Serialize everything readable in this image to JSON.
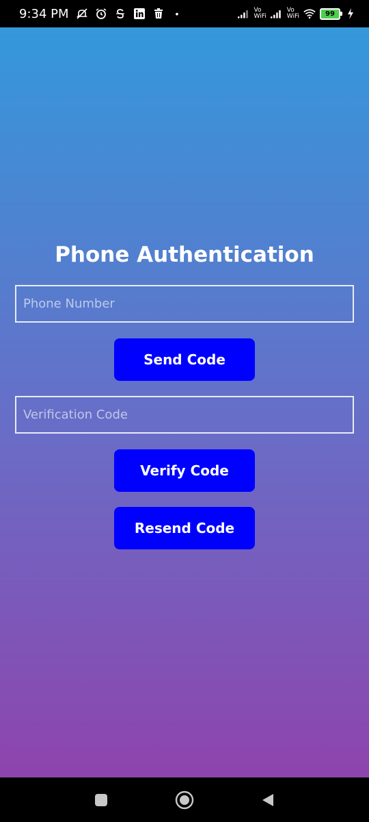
{
  "status_bar": {
    "time": "9:34 PM",
    "dot": "•",
    "vo_wifi_1": "Vo\nWiFi",
    "vo_wifi_2": "Vo\nWiFi",
    "battery": "99",
    "icons": [
      "mute-icon",
      "alarm-icon",
      "s-icon",
      "linkedin-icon",
      "delete-icon",
      "signal-icon",
      "wifi-icon",
      "charging-icon"
    ]
  },
  "screen": {
    "title": "Phone Authentication",
    "phone_placeholder": "Phone Number",
    "code_placeholder": "Verification Code",
    "send_code_label": "Send Code",
    "verify_code_label": "Verify Code",
    "resend_code_label": "Resend Code",
    "gradient_top": "#3498db",
    "gradient_bottom": "#8e44ad",
    "button_color": "#0000ff"
  },
  "nav_bar": {
    "icons": [
      "recents-square-icon",
      "home-circle-icon",
      "back-triangle-icon"
    ]
  }
}
